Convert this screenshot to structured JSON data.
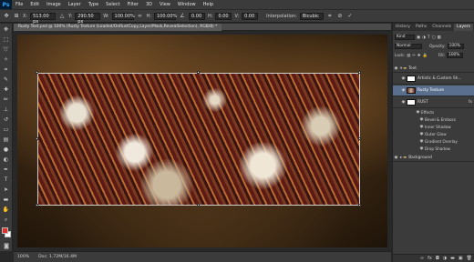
{
  "app": {
    "logo": "Ps"
  },
  "menu": [
    "File",
    "Edit",
    "Image",
    "Layer",
    "Type",
    "Select",
    "Filter",
    "3D",
    "View",
    "Window",
    "Help"
  ],
  "options": {
    "x_label": "X:",
    "x_value": "513.00 px",
    "y_label": "Y:",
    "y_value": "290.50 px",
    "w_label": "W:",
    "w_value": "100.00%",
    "h_label": "H:",
    "h_value": "100.00%",
    "angle_value": "0.00",
    "h_skew_label": "H:",
    "h_skew_value": "0.00",
    "v_skew_label": "V:",
    "v_skew_value": "0.00",
    "interp_label": "Interpolation:",
    "interp_value": "Bicubic"
  },
  "document": {
    "tab_title": "Rusty Text.psd @ 100% (Rusty Texture (Loaded/OnRustCopy,Layer/Mask,RevealSelection), RGB/8) *"
  },
  "status": {
    "zoom": "100%",
    "doc": "Doc: 1.72M/16.4M"
  },
  "panel": {
    "tabs": [
      {
        "label": "History",
        "active": false
      },
      {
        "label": "Paths",
        "active": false
      },
      {
        "label": "Channels",
        "active": false
      },
      {
        "label": "Layers",
        "active": true
      }
    ],
    "kind_label": "Kind",
    "blend_mode": "Normal",
    "opacity_label": "Opacity:",
    "opacity_value": "100%",
    "lock_label": "Lock:",
    "fill_label": "Fill:",
    "fill_value": "100%",
    "layers": [
      {
        "name": "Text",
        "type": "group"
      },
      {
        "name": "Artistic & Custom Sh...",
        "type": "layer"
      },
      {
        "name": "Rusty Texture",
        "type": "layer",
        "selected": true
      },
      {
        "name": "RUST",
        "type": "layer"
      },
      {
        "name": "Effects",
        "type": "effects"
      },
      {
        "name": "Bevel & Emboss",
        "type": "effect"
      },
      {
        "name": "Inner Shadow",
        "type": "effect"
      },
      {
        "name": "Outer Glow",
        "type": "effect"
      },
      {
        "name": "Gradient Overlay",
        "type": "effect"
      },
      {
        "name": "Drop Shadow",
        "type": "effect"
      },
      {
        "name": "Background",
        "type": "group"
      }
    ]
  },
  "colors": {
    "accent": "#31a8ff",
    "foreground": "#e0322a",
    "background": "#ffffff"
  }
}
